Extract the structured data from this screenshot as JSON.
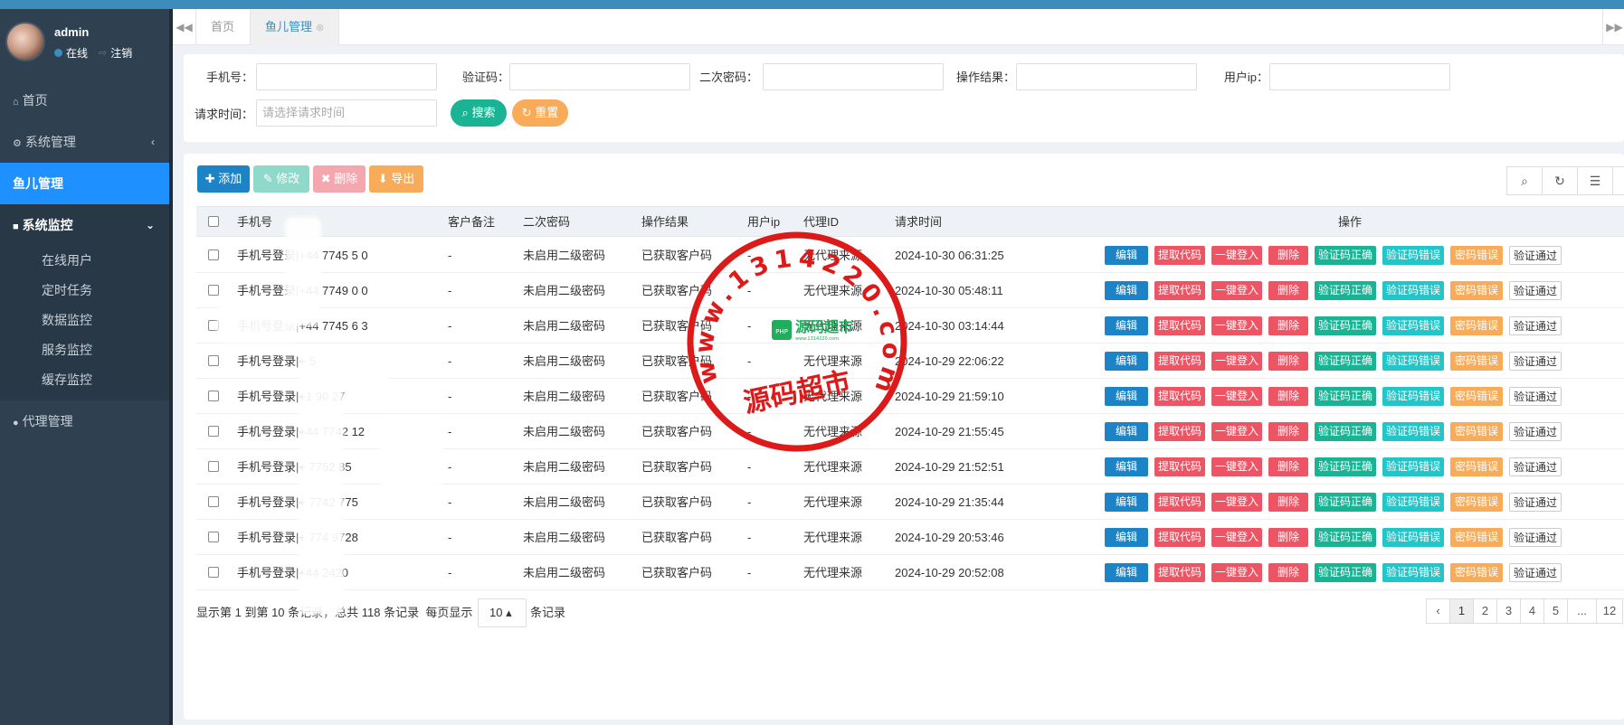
{
  "sidebar": {
    "username": "admin",
    "status_online": "在线",
    "logout": "注销",
    "items": [
      {
        "label": "首页",
        "icon": "home-icon"
      },
      {
        "label": "系统管理",
        "icon": "gear-icon"
      },
      {
        "label": "鱼儿管理",
        "icon": ""
      },
      {
        "label": "系统监控",
        "icon": "video-camera-icon"
      },
      {
        "label": "代理管理",
        "icon": "user-icon"
      }
    ],
    "sub_items": [
      "在线用户",
      "定时任务",
      "数据监控",
      "服务监控",
      "缓存监控"
    ]
  },
  "tabs": [
    {
      "label": "首页"
    },
    {
      "label": "鱼儿管理"
    }
  ],
  "search": {
    "phone_label": "手机号：",
    "code_label": "验证码：",
    "pwd2_label": "二次密码：",
    "result_label": "操作结果：",
    "ip_label": "用户ip：",
    "time_label": "请求时间：",
    "time_placeholder": "请选择请求时间",
    "search_btn": "搜索",
    "reset_btn": "重置"
  },
  "toolbar": {
    "add": "添加",
    "edit": "修改",
    "delete": "删除",
    "export": "导出"
  },
  "table": {
    "headers": [
      "手机号",
      "客户备注",
      "二次密码",
      "操作结果",
      "用户ip",
      "代理ID",
      "请求时间",
      "操作"
    ],
    "action_labels": [
      "编辑",
      "提取代码",
      "一键登入",
      "删除",
      "验证码正确",
      "验证码错误",
      "密码错误",
      "验证通过"
    ],
    "rows": [
      {
        "phone": "手机号登录|+44 7745 5  0",
        "remark": "-",
        "pwd2": "未启用二级密码",
        "result": "已获取客户码",
        "ip": "-",
        "agent": "无代理来源",
        "time": "2024-10-30 06:31:25"
      },
      {
        "phone": "手机号登录|+44 7749 0  0",
        "remark": "-",
        "pwd2": "未启用二级密码",
        "result": "已获取客户码",
        "ip": "-",
        "agent": "无代理来源",
        "time": "2024-10-30 05:48:11"
      },
      {
        "phone": "手机号登录|+44 7745 6  3",
        "remark": "-",
        "pwd2": "未启用二级密码",
        "result": "已获取客户码",
        "ip": "-",
        "agent": "无代理来源",
        "time": "2024-10-30 03:14:44"
      },
      {
        "phone": "手机号登录|+     5",
        "remark": "-",
        "pwd2": "未启用二级密码",
        "result": "已获取客户码",
        "ip": "-",
        "agent": "无代理来源",
        "time": "2024-10-29 22:06:22"
      },
      {
        "phone": "手机号登录|+1 90 27",
        "remark": "-",
        "pwd2": "未启用二级密码",
        "result": "已获取客户码",
        "ip": "-",
        "agent": "无代理来源",
        "time": "2024-10-29 21:59:10"
      },
      {
        "phone": "手机号登录|+44 7742  12",
        "remark": "-",
        "pwd2": "未启用二级密码",
        "result": "已获取客户码",
        "ip": "-",
        "agent": "无代理来源",
        "time": "2024-10-29 21:55:45"
      },
      {
        "phone": "手机号登录|+  7752  85",
        "remark": "-",
        "pwd2": "未启用二级密码",
        "result": "已获取客户码",
        "ip": "-",
        "agent": "无代理来源",
        "time": "2024-10-29 21:52:51"
      },
      {
        "phone": "手机号登录|+  7742  775",
        "remark": "-",
        "pwd2": "未启用二级密码",
        "result": "已获取客户码",
        "ip": "-",
        "agent": "无代理来源",
        "time": "2024-10-29 21:35:44"
      },
      {
        "phone": "手机号登录|+  774  9728",
        "remark": "-",
        "pwd2": "未启用二级密码",
        "result": "已获取客户码",
        "ip": "-",
        "agent": "无代理来源",
        "time": "2024-10-29 20:53:46"
      },
      {
        "phone": "手机号登录|+44   2420",
        "remark": "-",
        "pwd2": "未启用二级密码",
        "result": "已获取客户码",
        "ip": "-",
        "agent": "无代理来源",
        "time": "2024-10-29 20:52:08"
      }
    ]
  },
  "pagination": {
    "info": "显示第 1 到第 10 条记录，总共 118 条记录",
    "per_page_prefix": "每页显示",
    "page_size": "10",
    "per_page_suffix": "条记录",
    "pages": [
      "‹",
      "1",
      "2",
      "3",
      "4",
      "5",
      "...",
      "12"
    ]
  },
  "watermark": {
    "ring_text": "www.1314220.com",
    "cn_text": "源码超市",
    "logo_text": "源码超市",
    "logo_sub": "www.1314220.com",
    "logo_badge": "PHP"
  },
  "colors": {
    "sidebar_bg": "#2f4050",
    "accent": "#1e90ff",
    "top_bar": "#3c8dbc",
    "stamp_red": "#dd1a1a"
  }
}
